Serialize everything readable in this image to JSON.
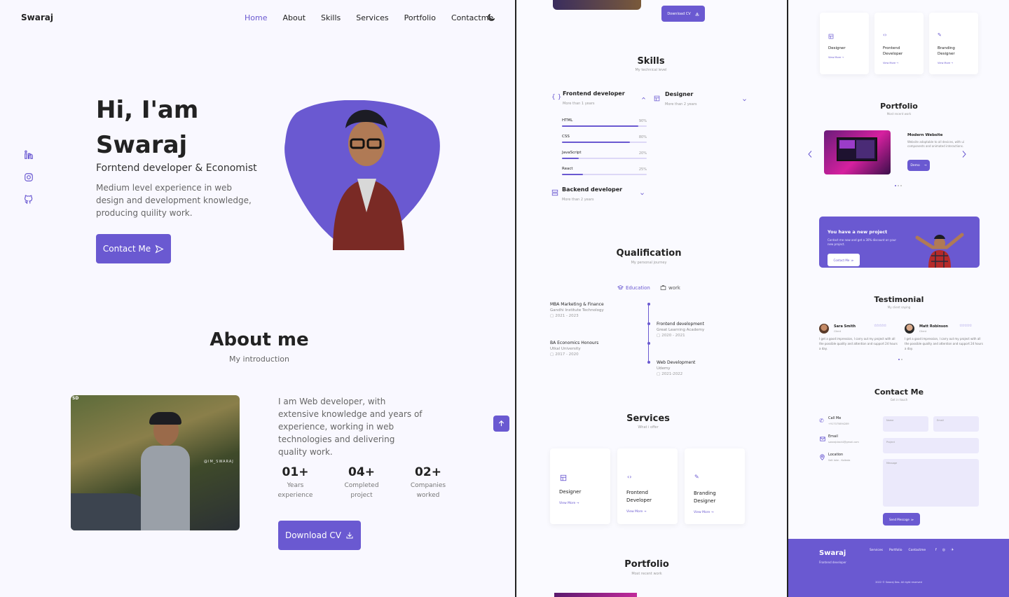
{
  "hero": {
    "logo": "Swaraj",
    "nav": [
      "Home",
      "About",
      "Skills",
      "Services",
      "Portfolio",
      "Contactme"
    ],
    "greet_line1": "Hi, I'am",
    "greet_line2": "Swaraj",
    "subtitle": "Forntend developer & Economist",
    "description": "Medium level experience in web design and development knowledge, producing quility work.",
    "contact_btn": "Contact Me"
  },
  "about": {
    "title": "About me",
    "subtitle": "My introduction",
    "photo_badge": "SD",
    "photo_watermark": "@IM_SWARAJ",
    "description": "I am Web developer, with extensive knowledge and years of experience, working in web technologies and delivering quality work.",
    "stats": [
      {
        "num": "01+",
        "l1": "Years",
        "l2": "experience"
      },
      {
        "num": "04+",
        "l1": "Completed",
        "l2": "project"
      },
      {
        "num": "02+",
        "l1": "Companies",
        "l2": "worked"
      }
    ],
    "download_btn": "Download CV"
  },
  "skills": {
    "top_btn": "Download CV",
    "title": "Skills",
    "subtitle": "My technical level",
    "frontend": {
      "title": "Frontend developer",
      "sub": "More than 1 years"
    },
    "designer": {
      "title": "Designer",
      "sub": "More than 2 years"
    },
    "bars": [
      {
        "name": "HTML",
        "pct": "90%",
        "value": 0.9
      },
      {
        "name": "CSS",
        "pct": "80%",
        "value": 0.8
      },
      {
        "name": "JavaScript",
        "pct": "20%",
        "value": 0.2
      },
      {
        "name": "React",
        "pct": "25%",
        "value": 0.25
      }
    ],
    "backend": {
      "title": "Backend developer",
      "sub": "More than 2 years"
    }
  },
  "qualification": {
    "title": "Qualification",
    "subtitle": "My personal journey",
    "tab_education": "Education",
    "tab_work": "work",
    "left": [
      {
        "title": "MBA Marketing & Finance",
        "place": "Gandhi Institute Technology",
        "date": "2021 - 2023"
      },
      {
        "title": "BA Economics Honours",
        "place": "Utkal University",
        "date": "2017 - 2020"
      }
    ],
    "right": [
      {
        "title": "Frontend development",
        "place": "Great Learning Academy",
        "date": "2020 - 2021"
      },
      {
        "title": "Web Development",
        "place": "Udemy",
        "date": "2021-2022"
      }
    ]
  },
  "services": {
    "title": "Services",
    "subtitle": "What i offer",
    "cards": [
      {
        "l1": "Designer",
        "l2": ""
      },
      {
        "l1": "Frontend",
        "l2": "Developer"
      },
      {
        "l1": "Branding",
        "l2": "Designer"
      }
    ],
    "view_more": "View More"
  },
  "portfolio": {
    "title": "Portfolio",
    "subtitle": "Most recent work",
    "project_title": "Modern Website",
    "project_desc": "Website adaptable to all devices, with ui components and animated interactions.",
    "demo_btn": "Demo"
  },
  "project_banner": {
    "title": "You have a new project",
    "desc": "Contact me now and get a 30% discount on your new project.",
    "btn": "Contact Me"
  },
  "testimonial": {
    "title": "Testimonial",
    "subtitle": "My client saying",
    "items": [
      {
        "name": "Sara Smith",
        "role": "Client",
        "stars": "☆☆☆☆☆",
        "text": "I get a good impression, I carry out my project with all the possible quality and attention and support 24 hours a day."
      },
      {
        "name": "Matt Robinson",
        "role": "Client",
        "stars": "☆☆☆☆☆",
        "text": "I get a good impression, I carry out my project with all the possible quality and attention and support 24 hours a day."
      }
    ]
  },
  "contact": {
    "title": "Contact Me",
    "subtitle": "Get in touch",
    "info": [
      {
        "label": "Call Me",
        "value": "+917075894289"
      },
      {
        "label": "Email",
        "value": "swarajdash4@gmail.com"
      },
      {
        "label": "Location",
        "value": "Salt lake - Kolkata"
      }
    ],
    "fields": {
      "name": "Name",
      "email": "Email",
      "project": "Project",
      "message": "Message"
    },
    "send_btn": "Send Message"
  },
  "footer": {
    "name": "Swaraj",
    "role": "Frontend developer",
    "links": [
      "Services",
      "Portfolio",
      "Contactme"
    ],
    "copyright": "2022 © Swaraj Das. All right reserved"
  },
  "colors": {
    "accent": "#6a59d1",
    "text": "#222222",
    "muted": "#777777"
  }
}
